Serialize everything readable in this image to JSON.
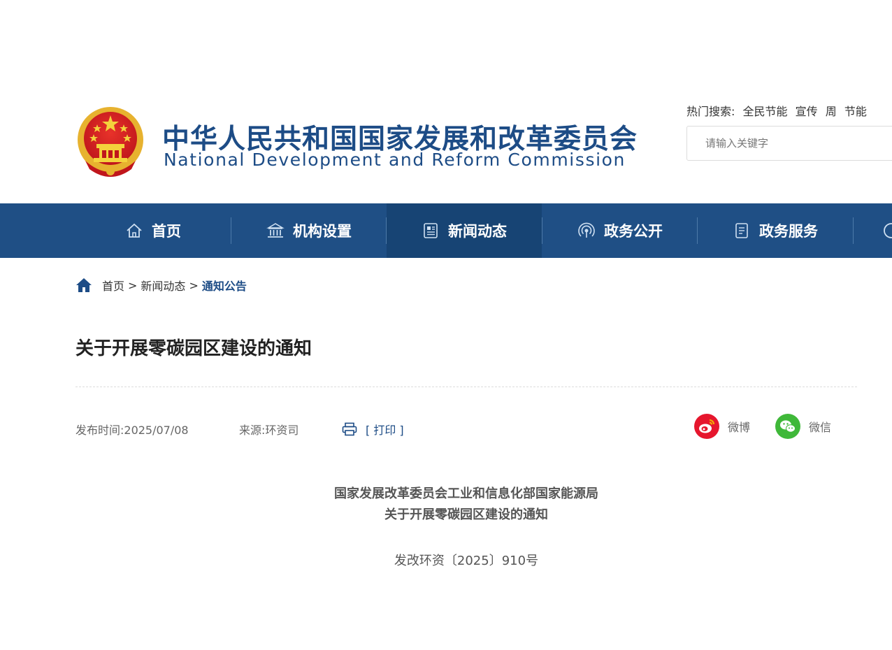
{
  "header": {
    "title_cn": "中华人民共和国国家发展和改革委员会",
    "title_en": "National Development and Reform Commission",
    "hot_search": {
      "label": "热门搜索:",
      "terms": [
        "全民节能",
        "宣传",
        "周",
        "节能"
      ]
    },
    "search": {
      "placeholder": "请输入关键字"
    }
  },
  "nav": {
    "items": [
      {
        "label": "首页",
        "icon": "home-icon"
      },
      {
        "label": "机构设置",
        "icon": "institution-icon"
      },
      {
        "label": "新闻动态",
        "icon": "news-icon",
        "active": true
      },
      {
        "label": "政务公开",
        "icon": "broadcast-icon"
      },
      {
        "label": "政务服务",
        "icon": "document-icon"
      }
    ]
  },
  "breadcrumb": {
    "items": [
      "首页",
      "新闻动态",
      "通知公告"
    ],
    "separator": ">"
  },
  "article": {
    "title": "关于开展零碳园区建设的通知",
    "publish_time": "发布时间:2025/07/08",
    "source": "来源:环资司",
    "print_label": "[ 打印 ]",
    "share": {
      "weibo": "微博",
      "wechat": "微信"
    },
    "doc_head_line1": "国家发展改革委员会工业和信息化部国家能源局",
    "doc_head_line2": "关于开展零碳园区建设的通知",
    "doc_number": "发改环资〔2025〕910号"
  },
  "colors": {
    "brand_blue": "#1d4c86",
    "nav_bg": "#1f4f85",
    "nav_active": "#174474",
    "weibo_red": "#e6162d",
    "wechat_green": "#3fb839"
  }
}
